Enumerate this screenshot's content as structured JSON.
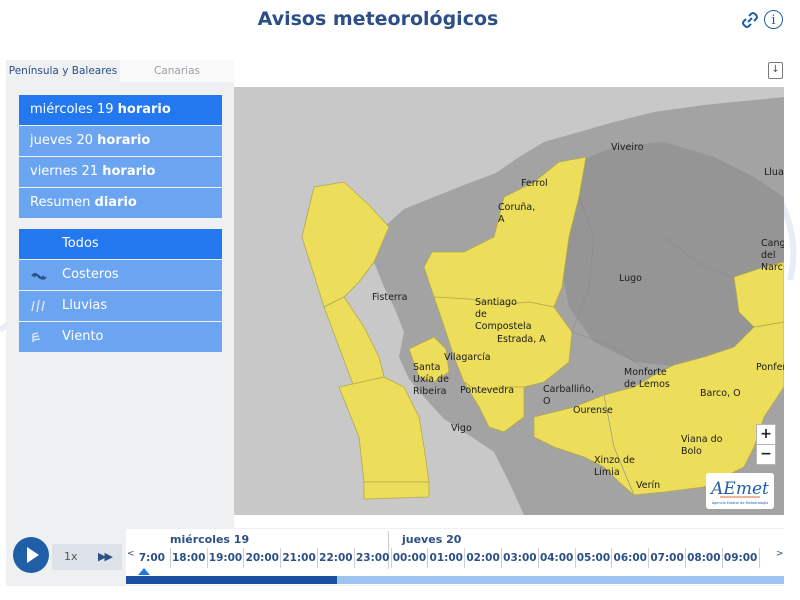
{
  "header": {
    "title": "Avisos meteorológicos"
  },
  "tabs": [
    {
      "label": "Península y Baleares",
      "active": true
    },
    {
      "label": "Canarias",
      "active": false
    }
  ],
  "days": [
    {
      "prefix": "miércoles 19",
      "suffix": "horario",
      "active": true
    },
    {
      "prefix": "jueves 20",
      "suffix": "horario",
      "active": false
    },
    {
      "prefix": "viernes 21",
      "suffix": "horario",
      "active": false
    },
    {
      "prefix": "Resumen",
      "suffix": "diario",
      "active": false
    }
  ],
  "warning_types": [
    {
      "label": "Todos",
      "icon": "all",
      "active": true
    },
    {
      "label": "Costeros",
      "icon": "waves-icon",
      "active": false
    },
    {
      "label": "Lluvias",
      "icon": "rain-icon",
      "active": false
    },
    {
      "label": "Viento",
      "icon": "wind-icon",
      "active": false
    }
  ],
  "map": {
    "warning_color": "#ecdd5a",
    "labels": [
      {
        "text": "Viveiro"
      },
      {
        "text": "Llua"
      },
      {
        "text": "Ferrol"
      },
      {
        "text": "Coruña,\nA"
      },
      {
        "text": "Cang\ndel\nNarc"
      },
      {
        "text": "Lugo"
      },
      {
        "text": "Fisterra"
      },
      {
        "text": "Santiago\nde\nCompostela"
      },
      {
        "text": "Estrada, A"
      },
      {
        "text": "Vilagarcía"
      },
      {
        "text": "Santa\nUxía de\nRibeira"
      },
      {
        "text": "Monforte\nde Lemos"
      },
      {
        "text": "Ponfer"
      },
      {
        "text": "Pontevedra"
      },
      {
        "text": "Carballiño,\nO"
      },
      {
        "text": "Barco, O"
      },
      {
        "text": "Ourense"
      },
      {
        "text": "Vigo"
      },
      {
        "text": "Viana do\nBolo"
      },
      {
        "text": "Xinzo de\nLimia"
      },
      {
        "text": "Verín"
      }
    ],
    "zoom_in": "+",
    "zoom_out": "−",
    "logo": {
      "text": "AEmet",
      "subtitle": "Agencia Estatal de Meteorología"
    }
  },
  "player": {
    "speed": "1x"
  },
  "timeline": {
    "day1": "miércoles 19",
    "day2": "jueves 20",
    "hours": [
      "7:00",
      "18:00",
      "19:00",
      "20:00",
      "21:00",
      "22:00",
      "23:00",
      "00:00",
      "01:00",
      "02:00",
      "03:00",
      "04:00",
      "05:00",
      "06:00",
      "07:00",
      "08:00",
      "09:00"
    ],
    "progress": 0.32
  }
}
